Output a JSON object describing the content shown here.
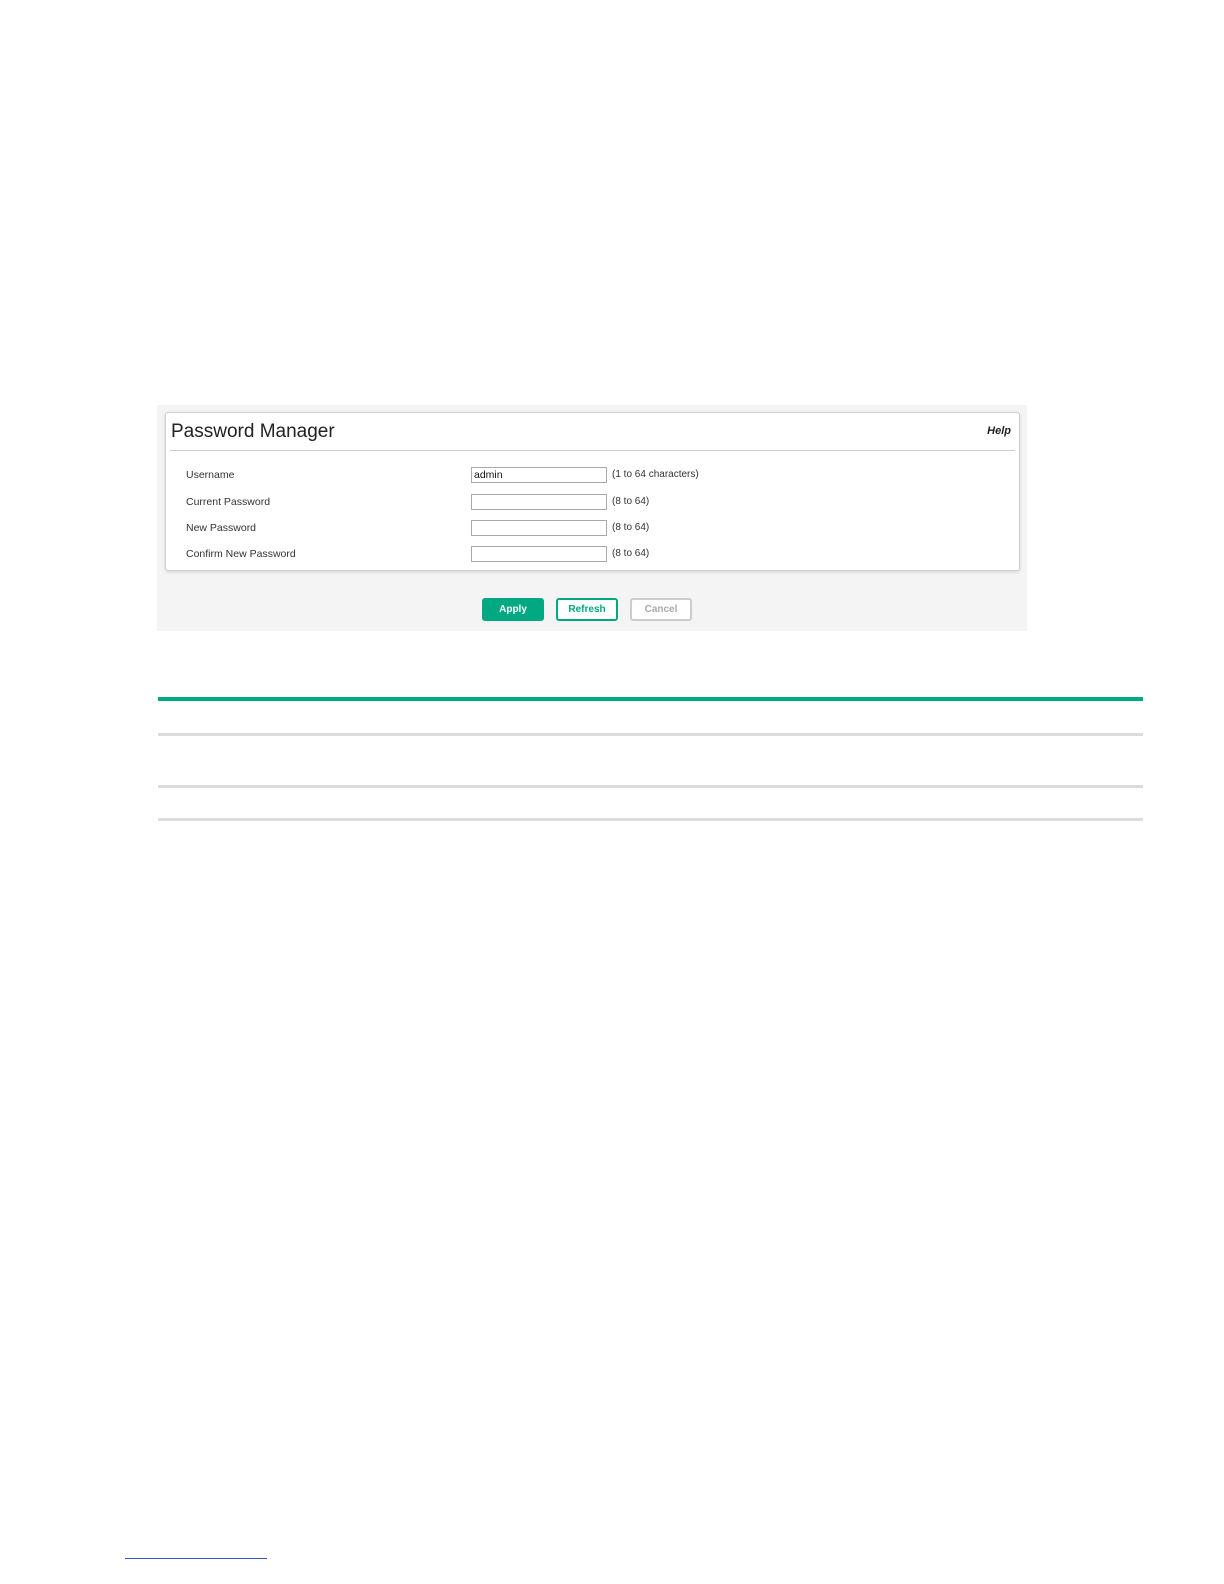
{
  "panel": {
    "title": "Password Manager",
    "help_label": "Help"
  },
  "form": {
    "username": {
      "label": "Username",
      "value": "admin",
      "hint": "(1 to 64 characters)"
    },
    "current_password": {
      "label": "Current Password",
      "value": "",
      "hint": "(8 to 64)"
    },
    "new_password": {
      "label": "New Password",
      "value": "",
      "hint": "(8 to 64)"
    },
    "confirm_password": {
      "label": "Confirm New Password",
      "value": "",
      "hint": "(8 to 64)"
    }
  },
  "buttons": {
    "apply": "Apply",
    "refresh": "Refresh",
    "cancel": "Cancel"
  },
  "colors": {
    "accent": "#01a982",
    "panel_background": "#f4f4f4",
    "rule_gray": "#dcdcdc"
  }
}
